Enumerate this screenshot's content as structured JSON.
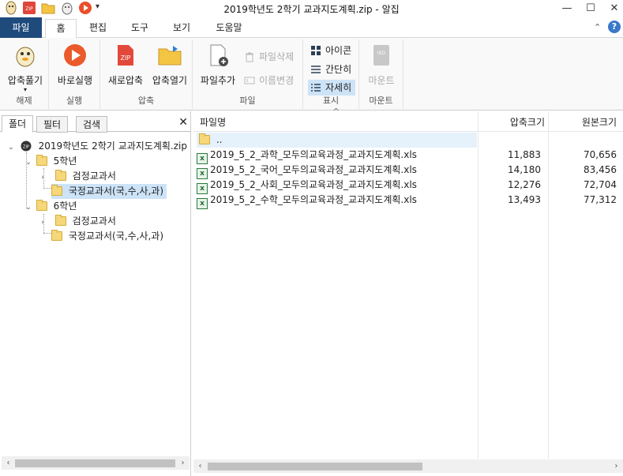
{
  "window": {
    "title": "2019학년도 2학기 교과지도계획.zip - 알집",
    "minimize": "—",
    "maximize": "☐",
    "close": "✕"
  },
  "tabs": {
    "file": "파일",
    "items": [
      "홈",
      "편집",
      "도구",
      "보기",
      "도움말"
    ],
    "active_index": 0,
    "help": "?"
  },
  "ribbon": {
    "groups": [
      {
        "label": "해제",
        "buttons": [
          {
            "label": "압축풀기",
            "icon": "mascot-icon"
          }
        ]
      },
      {
        "label": "실행",
        "buttons": [
          {
            "label": "바로실행",
            "icon": "play-icon"
          }
        ]
      },
      {
        "label": "압축",
        "buttons": [
          {
            "label": "새로압축",
            "icon": "zip-icon"
          },
          {
            "label": "압축열기",
            "icon": "folder-open-icon"
          }
        ]
      },
      {
        "label": "파일",
        "buttons": [
          {
            "label": "파일추가",
            "icon": "file-add-icon"
          }
        ],
        "small": [
          {
            "label": "파일삭제",
            "icon": "trash-icon",
            "disabled": true
          },
          {
            "label": "이름변경",
            "icon": "rename-icon",
            "disabled": true
          }
        ]
      },
      {
        "label": "표시",
        "small": [
          {
            "label": "아이콘",
            "icon": "grid-icon"
          },
          {
            "label": "간단히",
            "icon": "list-icon"
          },
          {
            "label": "자세히",
            "icon": "details-icon",
            "selected": true
          }
        ]
      },
      {
        "label": "마운트",
        "buttons": [
          {
            "label": "마운트",
            "icon": "iso-icon",
            "disabled": true
          }
        ]
      }
    ],
    "dropdown_arrow": "▾"
  },
  "left_panel": {
    "tabs": [
      "폴더",
      "필터",
      "검색"
    ],
    "active_tab": 0,
    "close": "✕",
    "tree": [
      {
        "label": "2019학년도 2학기 교과지도계획.zip",
        "level": 0,
        "expander": "⌄",
        "type": "zip"
      },
      {
        "label": "5학년",
        "level": 1,
        "expander": "⌄",
        "type": "folder"
      },
      {
        "label": "검정교과서",
        "level": 2,
        "expander": "›",
        "type": "folder"
      },
      {
        "label": "국정교과서(국,수,사,과)",
        "level": 2,
        "expander": "",
        "type": "folder",
        "selected": true
      },
      {
        "label": "6학년",
        "level": 1,
        "expander": "⌄",
        "type": "folder"
      },
      {
        "label": "검정교과서",
        "level": 2,
        "expander": "›",
        "type": "folder"
      },
      {
        "label": "국정교과서(국,수,사,과)",
        "level": 2,
        "expander": "",
        "type": "folder"
      }
    ]
  },
  "file_list": {
    "columns": {
      "name": "파일명",
      "compressed": "압축크기",
      "original": "원본크기"
    },
    "sort_indicator": "^",
    "parent_entry": "..",
    "rows": [
      {
        "name": "2019_5_2_과학_모두의교육과정_교과지도계획.xls",
        "compressed": "11,883",
        "original": "70,656"
      },
      {
        "name": "2019_5_2_국어_모두의교육과정_교과지도계획.xls",
        "compressed": "14,180",
        "original": "83,456"
      },
      {
        "name": "2019_5_2_사회_모두의교육과정_교과지도계획.xls",
        "compressed": "12,276",
        "original": "72,704"
      },
      {
        "name": "2019_5_2_수학_모두의교육과정_교과지도계획.xls",
        "compressed": "13,493",
        "original": "77,312"
      }
    ]
  },
  "scroll": {
    "left_arrow": "‹",
    "right_arrow": "›"
  },
  "colors": {
    "file_tab": "#1f4a7c",
    "selection": "#cde3f7",
    "help": "#3a78c9"
  }
}
